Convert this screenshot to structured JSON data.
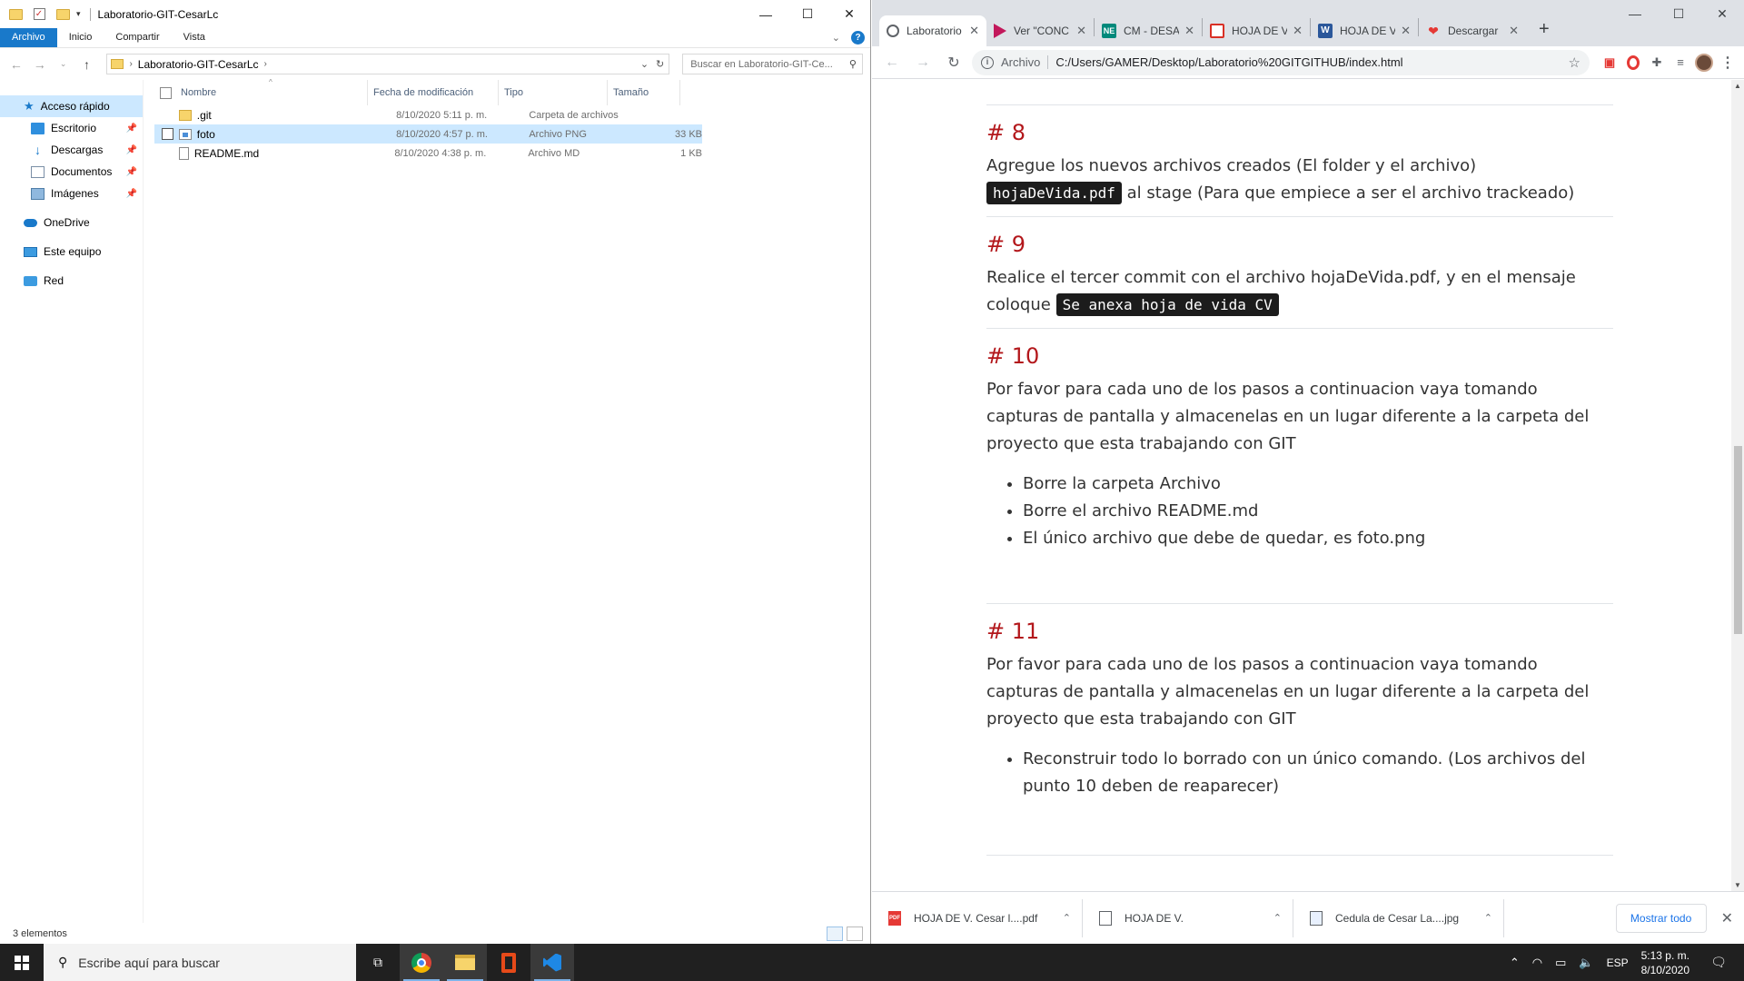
{
  "explorer": {
    "title": "Laboratorio-GIT-CesarLc",
    "ribbon_tabs": [
      "Archivo",
      "Inicio",
      "Compartir",
      "Vista"
    ],
    "address": {
      "segment": "Laboratorio-GIT-CesarLc"
    },
    "search_placeholder": "Buscar en Laboratorio-GIT-Ce...",
    "nav": {
      "quick_access": "Acceso rápido",
      "items": [
        "Escritorio",
        "Descargas",
        "Documentos",
        "Imágenes"
      ],
      "onedrive": "OneDrive",
      "this_pc": "Este equipo",
      "network": "Red"
    },
    "columns": {
      "name": "Nombre",
      "date": "Fecha de modificación",
      "type": "Tipo",
      "size": "Tamaño"
    },
    "files": [
      {
        "name": ".git",
        "date": "8/10/2020 5:11 p. m.",
        "type": "Carpeta de archivos",
        "size": "",
        "icon": "folder-icon"
      },
      {
        "name": "foto",
        "date": "8/10/2020 4:57 p. m.",
        "type": "Archivo PNG",
        "size": "33 KB",
        "icon": "png-file-icon"
      },
      {
        "name": "README.md",
        "date": "8/10/2020 4:38 p. m.",
        "type": "Archivo MD",
        "size": "1 KB",
        "icon": "md-file-icon"
      }
    ],
    "status": "3 elementos"
  },
  "browser": {
    "tabs": [
      {
        "title": "Laboratorio",
        "icon": "globe-icon",
        "active": true
      },
      {
        "title": "Ver \"CONC",
        "icon": "play-icon"
      },
      {
        "title": "CM - DESA",
        "icon": "ne-icon"
      },
      {
        "title": "HOJA DE V",
        "icon": "gmail-icon"
      },
      {
        "title": "HOJA DE V",
        "icon": "word-icon"
      },
      {
        "title": "Descargar",
        "icon": "heart-icon"
      }
    ],
    "omnibox": {
      "label": "Archivo",
      "url": "C:/Users/GAMER/Desktop/Laboratorio%20GITGITHUB/index.html"
    },
    "content": {
      "steps": [
        {
          "heading": "# 8",
          "text_before": "Agregue los nuevos archivos creados (El folder y el archivo) ",
          "code": "hojaDeVida.pdf",
          "text_after": " al stage (Para que empiece a ser el archivo trackeado)"
        },
        {
          "heading": "# 9",
          "text_before": "Realice el tercer commit con el archivo hojaDeVida.pdf, y en el mensaje coloque ",
          "code": "Se anexa hoja de vida CV",
          "text_after": ""
        },
        {
          "heading": "# 10",
          "text": "Por favor para cada uno de los pasos a continuacion vaya tomando capturas de pantalla y almacenelas en un lugar diferente a la carpeta del proyecto que esta trabajando con GIT",
          "bullets": [
            "Borre la carpeta Archivo",
            "Borre el archivo README.md",
            "El único archivo que debe de quedar, es foto.png"
          ]
        },
        {
          "heading": "# 11",
          "text": "Por favor para cada uno de los pasos a continuacion vaya tomando capturas de pantalla y almacenelas en un lugar diferente a la carpeta del proyecto que esta trabajando con GIT",
          "bullets": [
            "Reconstruir todo lo borrado con un único comando. (Los archivos del punto 10 deben de reaparecer)"
          ]
        }
      ]
    },
    "downloads": {
      "items": [
        {
          "name": "HOJA DE V. Cesar l....pdf",
          "icon": "pdf-icon"
        },
        {
          "name": "HOJA DE V.",
          "icon": "doc-icon"
        },
        {
          "name": "Cedula de Cesar La....jpg",
          "icon": "image-icon"
        }
      ],
      "show_all": "Mostrar todo"
    }
  },
  "taskbar": {
    "search_placeholder": "Escribe aquí para buscar",
    "language": "ESP",
    "time": "5:13 p. m.",
    "date": "8/10/2020"
  }
}
